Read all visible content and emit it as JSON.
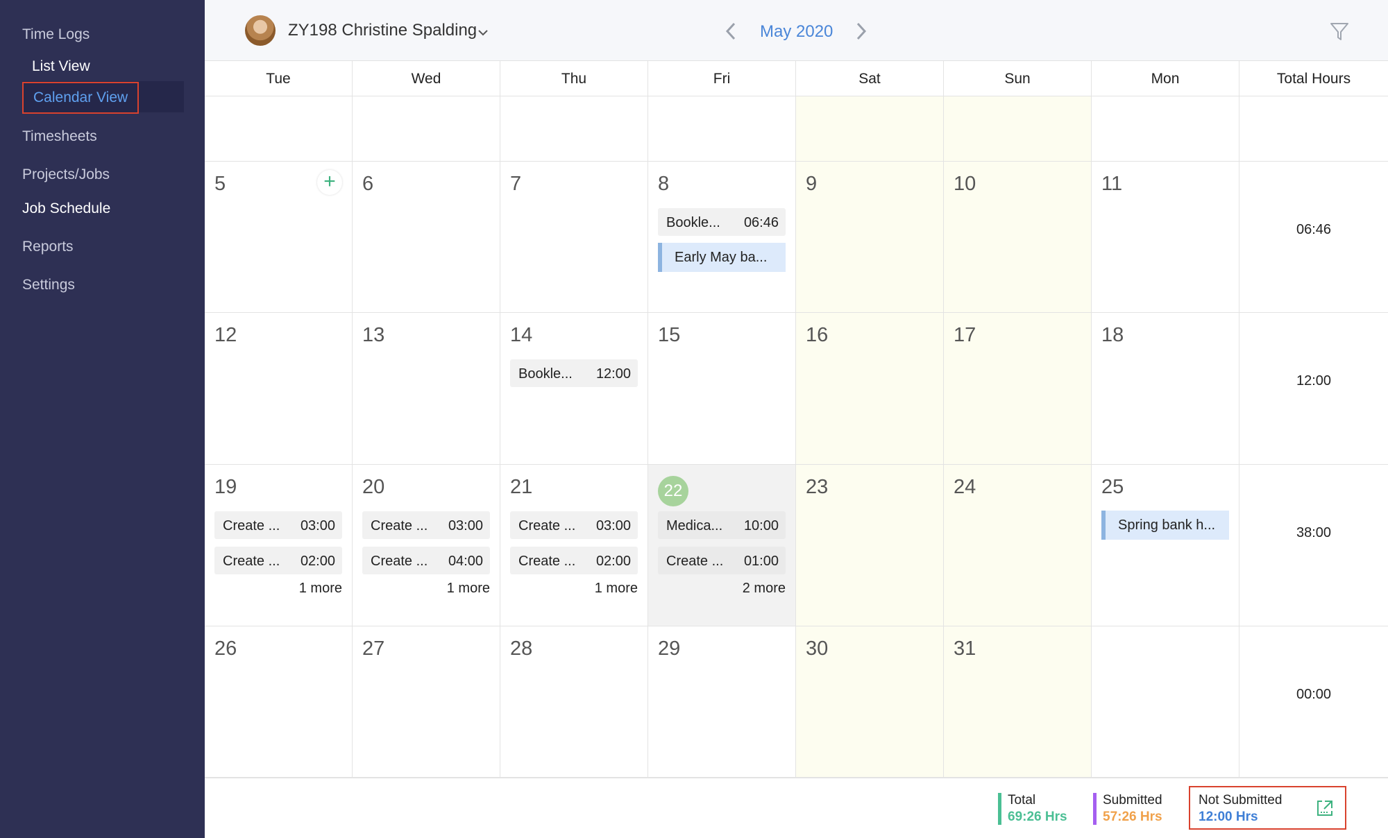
{
  "sidebar": {
    "time_logs": "Time Logs",
    "list_view": "List View",
    "calendar_view": "Calendar View",
    "timesheets": "Timesheets",
    "projects_jobs": "Projects/Jobs",
    "job_schedule": "Job Schedule",
    "reports": "Reports",
    "settings": "Settings"
  },
  "header": {
    "user_name": "ZY198 Christine Spalding",
    "month": "May 2020",
    "icons": [
      "avatar",
      "chevron-down-icon",
      "chevron-left-icon",
      "chevron-right-icon",
      "filter-icon"
    ]
  },
  "day_headers": [
    "Tue",
    "Wed",
    "Thu",
    "Fri",
    "Sat",
    "Sun",
    "Mon",
    "Total Hours"
  ],
  "weeks": [
    {
      "days": [
        "",
        "",
        "",
        "",
        "",
        "",
        ""
      ],
      "total": ""
    },
    {
      "days": [
        "5",
        "6",
        "7",
        "8",
        "9",
        "10",
        "11"
      ],
      "total": "06:46"
    },
    {
      "days": [
        "12",
        "13",
        "14",
        "15",
        "16",
        "17",
        "18"
      ],
      "total": "12:00"
    },
    {
      "days": [
        "19",
        "20",
        "21",
        "22",
        "23",
        "24",
        "25"
      ],
      "total": "38:00"
    },
    {
      "days": [
        "26",
        "27",
        "28",
        "29",
        "30",
        "31",
        ""
      ],
      "total": "00:00"
    }
  ],
  "entries": {
    "may8": {
      "name": "Bookle...",
      "time": "06:46",
      "holiday": "Early May ba..."
    },
    "may14": {
      "name": "Bookle...",
      "time": "12:00"
    },
    "may19": {
      "e1_name": "Create ...",
      "e1_time": "03:00",
      "e2_name": "Create ...",
      "e2_time": "02:00",
      "more": "1 more"
    },
    "may20": {
      "e1_name": "Create ...",
      "e1_time": "03:00",
      "e2_name": "Create ...",
      "e2_time": "04:00",
      "more": "1 more"
    },
    "may21": {
      "e1_name": "Create ...",
      "e1_time": "03:00",
      "e2_name": "Create ...",
      "e2_time": "02:00",
      "more": "1 more"
    },
    "may22": {
      "e1_name": "Medica...",
      "e1_time": "10:00",
      "e2_name": "Create ...",
      "e2_time": "01:00",
      "more": "2 more"
    },
    "may25": {
      "holiday": "Spring bank h..."
    }
  },
  "add_button": "+",
  "footer": {
    "total_label": "Total",
    "total_value": "69:26 Hrs",
    "submitted_label": "Submitted",
    "submitted_value": "57:26 Hrs",
    "not_submitted_label": "Not Submitted",
    "not_submitted_value": "12:00 Hrs"
  },
  "colors": {
    "sidebar_bg": "#2e3054",
    "accent_blue": "#4a86d8",
    "total_green": "#4bbf94",
    "submitted_orange": "#f0a14a",
    "submitted_bar": "#a55ff0",
    "not_submitted_blue": "#3f7fd6",
    "weekend_bg": "#fdfdf0",
    "today_green": "#a7d39c",
    "highlight_red": "#d9422e"
  }
}
